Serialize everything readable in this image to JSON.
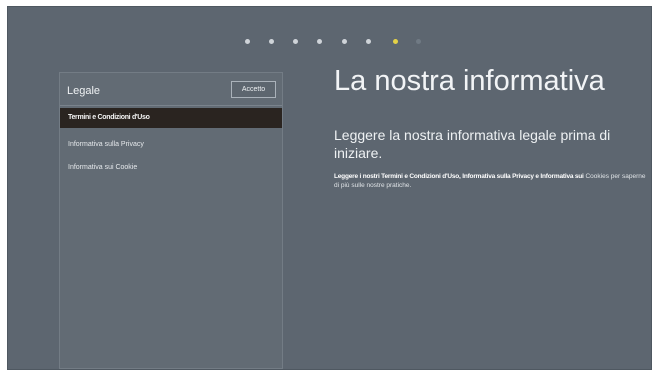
{
  "pagination": {
    "total": 8,
    "active_index": 6
  },
  "panel": {
    "title": "Legale",
    "accept_label": "Accetto",
    "items": [
      {
        "label": "Termini e Condizioni d'Uso",
        "selected": true
      },
      {
        "label": "Informativa sulla Privacy",
        "selected": false
      },
      {
        "label": "Informativa sui Cookie",
        "selected": false
      }
    ]
  },
  "content": {
    "heading": "La nostra informativa",
    "subheading": "Leggere la nostra informativa legale prima di iniziare.",
    "body_bold": "Leggere i nostri Termini e Condizioni d'Uso, Informativa sulla Privacy e Informativa sui",
    "body_rest": "Cookies per saperne di più sulle nostre pratiche."
  },
  "colors": {
    "background": "#5d6670",
    "panel": "#626b74",
    "selected_item": "#2a2420",
    "active_dot": "#e4d247"
  }
}
